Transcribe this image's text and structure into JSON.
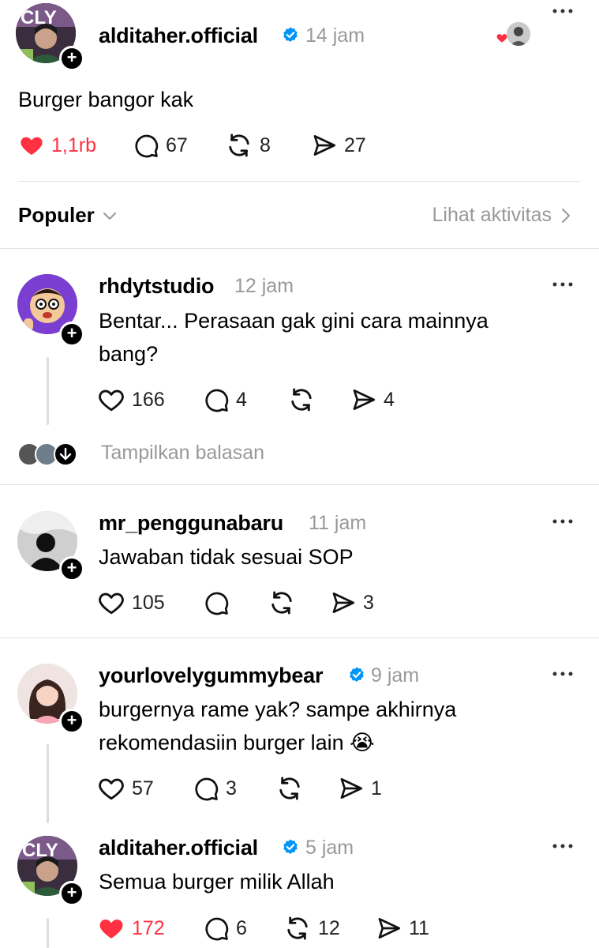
{
  "main_post": {
    "username": "alditaher.official",
    "time": "14 jam",
    "text": "Burger bangor kak",
    "likes": "1,1rb",
    "replies": "67",
    "reposts": "8",
    "shares": "27",
    "liked": true
  },
  "sort_bar": {
    "label": "Populer",
    "activity_link": "Lihat aktivitas"
  },
  "replies": [
    {
      "username": "rhdytstudio",
      "time": "12 jam",
      "text_line1": "Bentar... Perasaan gak gini cara mainnya",
      "text_line2": "bang?",
      "likes": "166",
      "replies": "4",
      "reposts": "",
      "shares": "4",
      "show_replies": "Tampilkan balasan"
    },
    {
      "username": "mr_penggunabaru",
      "time": "11 jam",
      "text_line1": "Jawaban tidak sesuai SOP",
      "likes": "105",
      "replies": "",
      "reposts": "",
      "shares": "3"
    },
    {
      "username": "yourlovelygummybear",
      "verified": true,
      "time": "9 jam",
      "text_line1": "burgernya rame yak? sampe akhirnya",
      "text_line2": "rekomendasiin burger lain 😭",
      "likes": "57",
      "replies": "3",
      "reposts": "",
      "shares": "1"
    },
    {
      "username": "alditaher.official",
      "verified": true,
      "time": "5 jam",
      "text_line1": "Semua burger milik Allah",
      "likes": "172",
      "replies": "6",
      "reposts": "12",
      "shares": "11",
      "liked": true
    }
  ],
  "colors": {
    "like_red": "#ff3040",
    "verified_blue": "#0095f6",
    "muted_gray": "#999999"
  }
}
